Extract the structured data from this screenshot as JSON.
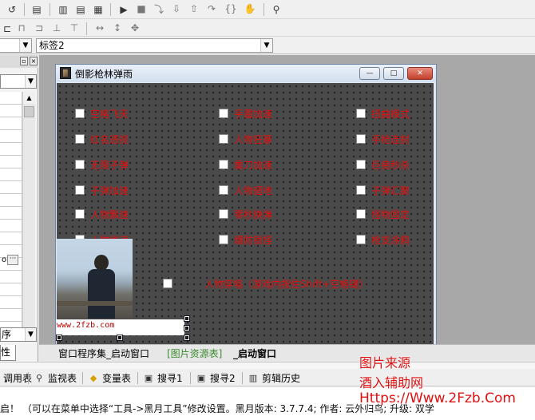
{
  "toolbar_row3": {
    "left_combo_value": "",
    "object_combo_value": "标签2"
  },
  "left_panel": {
    "partial_field_value": "om",
    "ellipsis_button": "···",
    "sort_value": "序",
    "tab_label": "性"
  },
  "window": {
    "title": "倒影枪林弹雨",
    "minimize": "—",
    "maximize": "□",
    "close": "✕"
  },
  "options": [
    {
      "label": "空格飞天"
    },
    {
      "label": "手雷加速"
    },
    {
      "label": "扭曲模式"
    },
    {
      "label": "红名透视"
    },
    {
      "label": "人物狂暴"
    },
    {
      "label": "手枪连射"
    },
    {
      "label": "无限子弹"
    },
    {
      "label": "重刀加速"
    },
    {
      "label": "巨兽秒杀"
    },
    {
      "label": "子弹加速"
    },
    {
      "label": "人物遁地"
    },
    {
      "label": "子弹汇聚"
    },
    {
      "label": "人物飘速"
    },
    {
      "label": "零秒换弹"
    },
    {
      "label": "怪物固定"
    },
    {
      "label": "人物微速"
    },
    {
      "label": "爆防锁怪"
    },
    {
      "label": "枪支涂鸦"
    }
  ],
  "special_option": {
    "label": "人物穿墙（游戏内按住Shift+空格键）"
  },
  "watermark_strip": "www.2fzb.com",
  "source_tabs": [
    {
      "label": "窗口程序集_启动窗口"
    },
    {
      "label": "[图片资源表]"
    },
    {
      "label": "_启动窗口"
    }
  ],
  "bottom_tabs": [
    {
      "label": "调用表",
      "icon": "list-icon"
    },
    {
      "label": "监视表",
      "icon": "magnifier-icon"
    },
    {
      "label": "变量表",
      "icon": "variables-icon"
    },
    {
      "label": "搜寻1",
      "icon": "search-one-icon"
    },
    {
      "label": "搜寻2",
      "icon": "search-two-icon"
    },
    {
      "label": "剪辑历史",
      "icon": "clipboard-icon"
    }
  ],
  "status_text": "启！  （可以在菜单中选择“工具->黑月工具”修改设置。黑月版本: 3.7.7.4; 作者: 云外归鸟; 升级: 双学",
  "overlay_watermark": {
    "line1": "图片来源",
    "line2": "酒入辅助网",
    "line3": "Https://Www.2Fzb.Com"
  },
  "colors": {
    "option_text": "#e21010",
    "client_background": "#4a4a4a",
    "overlay_text": "#e01010"
  }
}
